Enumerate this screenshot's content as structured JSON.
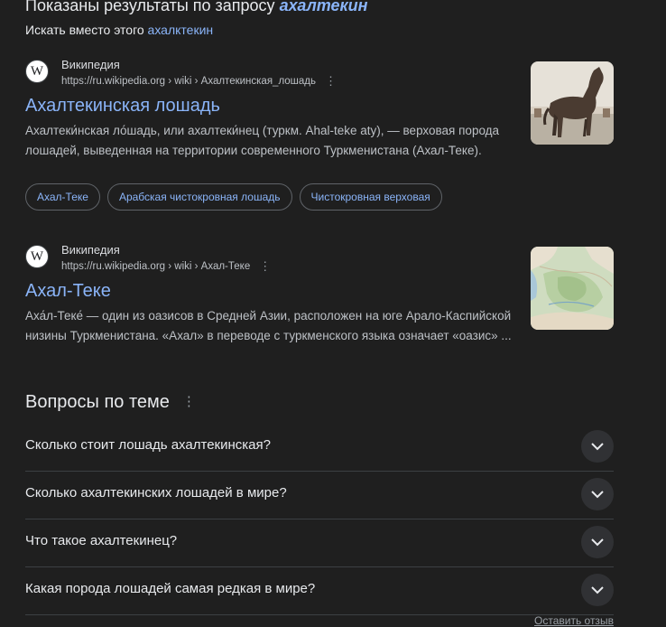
{
  "correction": {
    "prefix": "Показаны результаты по запросу ",
    "query": "ахалтекин",
    "instead_prefix": "Искать вместо этого ",
    "instead_query": "ахалктекин"
  },
  "results": [
    {
      "site": "Википедия",
      "favicon": "W",
      "url": "https://ru.wikipedia.org › wiki › Ахалтекинская_лошадь",
      "title": "Ахалтекинская лошадь",
      "snippet": "Ахалтеки́нская ло́шадь, или ахалтеки́нец (туркм. Ahal-teke aty), — верховая порода лошадей, выведенная на территории современного Туркменистана (Ахал-Теке).",
      "thumbnail": "horse-photo"
    },
    {
      "site": "Википедия",
      "favicon": "W",
      "url": "https://ru.wikipedia.org › wiki › Ахал-Теке",
      "title": "Ахал-Теке",
      "snippet": "Аха́л-Теке́ — один из оазисов в Средней Азии, расположен на юге Арало-Каспийской низины Туркменистана. «Ахал» в переводе с туркменского языка означает «оазис» ...",
      "thumbnail": "map-photo"
    }
  ],
  "chips": [
    "Ахал-Теке",
    "Арабская чистокровная лошадь",
    "Чистокровная верховая"
  ],
  "paa": {
    "heading": "Вопросы по теме",
    "questions": [
      "Сколько стоит лошадь ахалтекинская?",
      "Сколько ахалтекинских лошадей в мире?",
      "Что такое ахалтекинец?",
      "Какая порода лошадей самая редкая в мире?"
    ]
  },
  "feedback": "Оставить отзыв",
  "colors": {
    "background": "#1f1f1f",
    "link": "#8ab4f8",
    "text": "#bdc1c6"
  }
}
